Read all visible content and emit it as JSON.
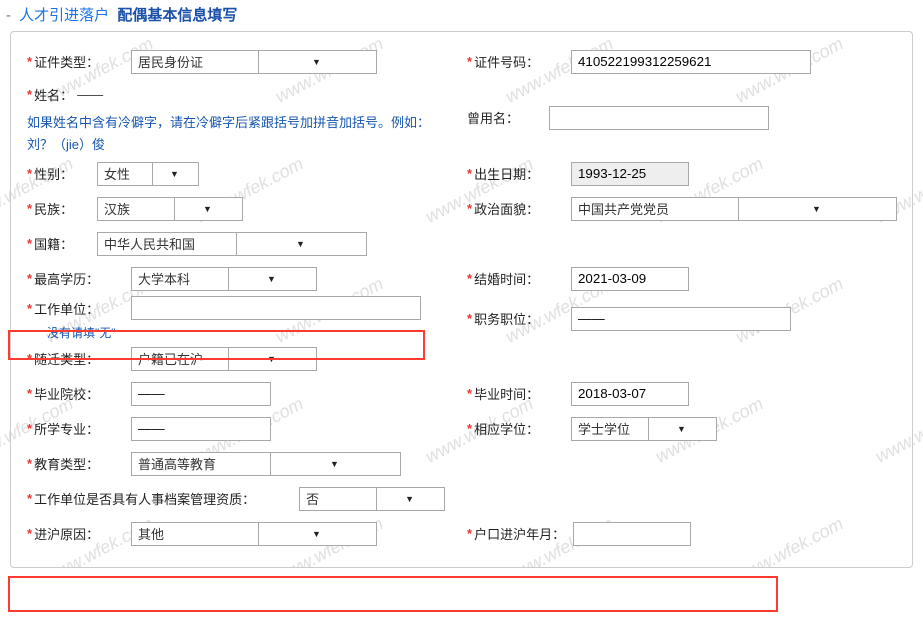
{
  "watermark": "www.wfek.com",
  "header": {
    "crumb1": "人才引进落户",
    "crumb2": "配偶基本信息填写"
  },
  "labels": {
    "id_type": "证件类型：",
    "id_number": "证件号码：",
    "name": "姓名：",
    "former_name": "曾用名：",
    "gender": "性别：",
    "birth_date": "出生日期：",
    "ethnicity": "民族：",
    "political": "政治面貌：",
    "nationality": "国籍：",
    "highest_edu": "最高学历：",
    "marriage_date": "结婚时间：",
    "work_unit": "工作单位：",
    "job_title": "职务职位：",
    "move_type": "随迁类型：",
    "grad_school": "毕业院校：",
    "grad_date": "毕业时间：",
    "major": "所学专业：",
    "degree": "相应学位：",
    "edu_type": "教育类型：",
    "archive_q": "工作单位是否具有人事档案管理资质：",
    "reason_sh": "进沪原因：",
    "hukou_date": "户口进沪年月："
  },
  "values": {
    "id_type": "居民身份证",
    "id_number": "410522199312259621",
    "name": "——",
    "former_name": "",
    "gender": "女性",
    "birth_date": "1993-12-25",
    "ethnicity": "汉族",
    "political": "中国共产党党员",
    "nationality": "中华人民共和国",
    "highest_edu": "大学本科",
    "marriage_date": "2021-03-09",
    "work_unit": "",
    "job_title": "——",
    "move_type": "户籍已在沪",
    "grad_school": "——",
    "grad_date": "2018-03-07",
    "major": "——",
    "degree": "学士学位",
    "edu_type": "普通高等教育",
    "archive_q": "否",
    "reason_sh": "其他",
    "hukou_date": ""
  },
  "hints": {
    "name_rare": "如果姓名中含有冷僻字，请在冷僻字后紧跟括号加拼音加括号。例如：刘？（jie）俊",
    "work_unit_none": "没有请填\"无\""
  }
}
